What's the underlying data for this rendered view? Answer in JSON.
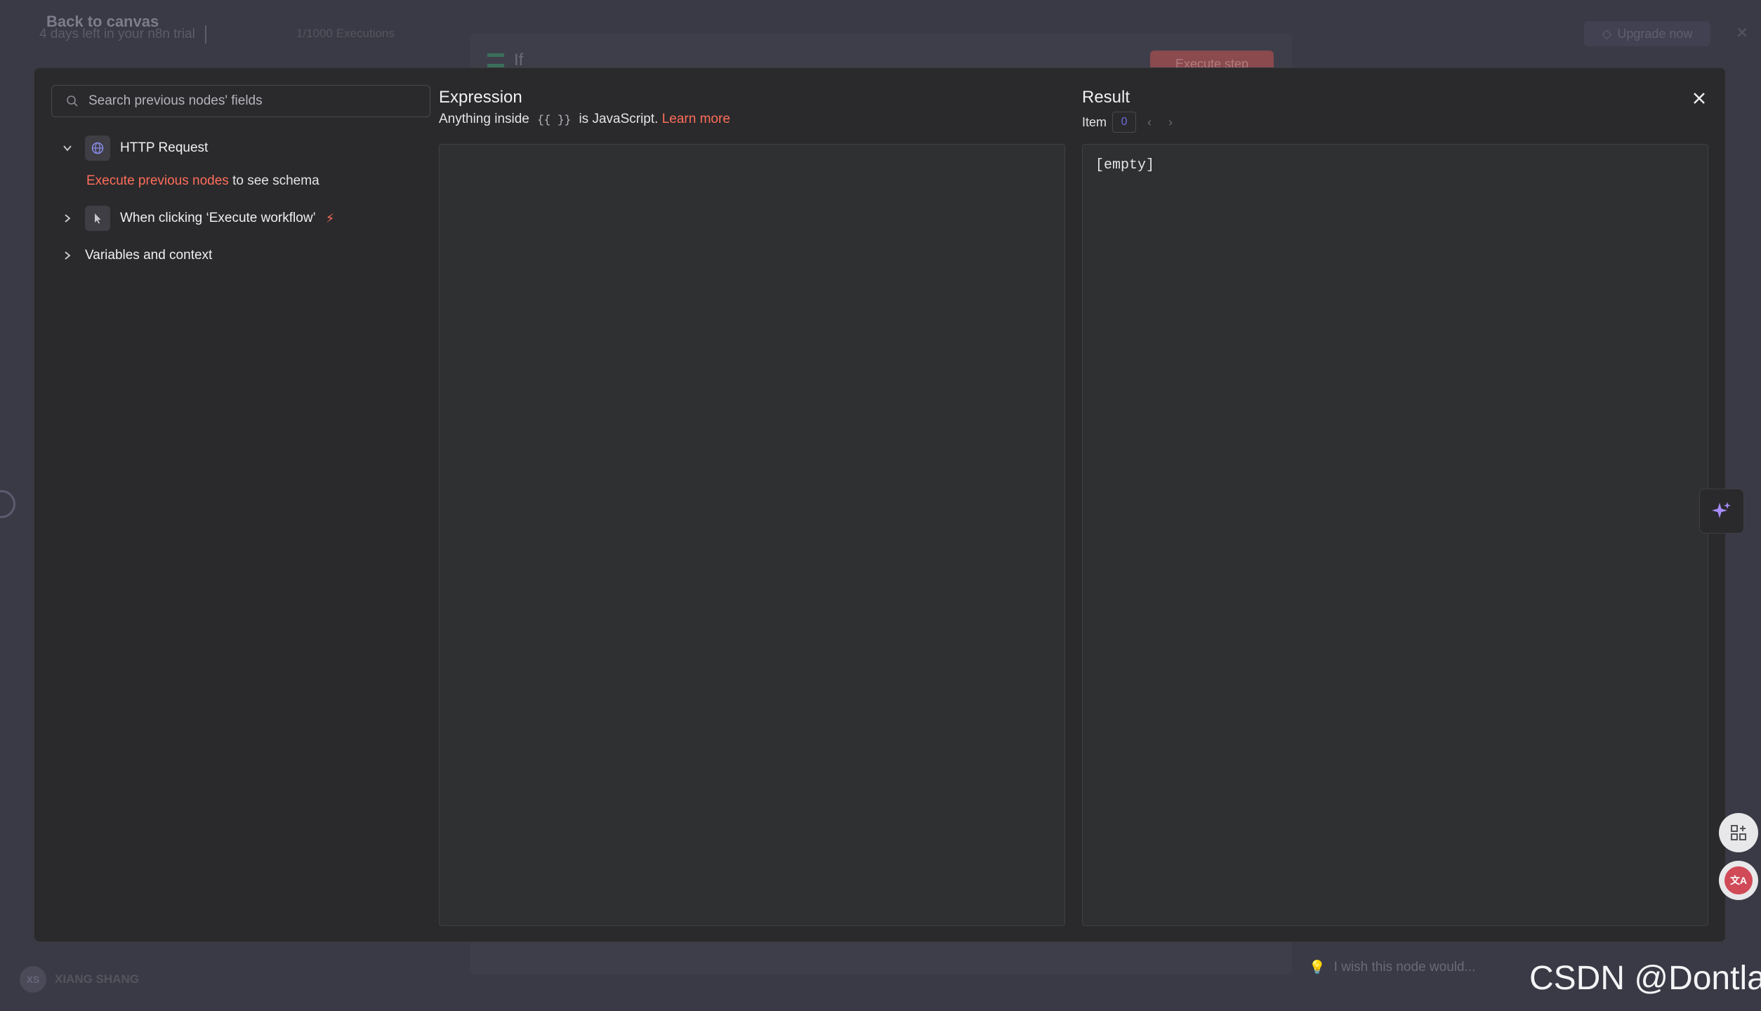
{
  "background": {
    "back_label": "Back to canvas",
    "trial_text": "4 days left in your n8n trial",
    "executions_text": "1/1000 Executions",
    "upgrade_label": "Upgrade now",
    "node_name": "If",
    "execute_step_label": "Execute step",
    "user_initials": "XS",
    "user_name": "XIANG SHANG",
    "wish_placeholder": "I wish this node would..."
  },
  "search": {
    "placeholder": "Search previous nodes' fields"
  },
  "tree": {
    "http_request": "HTTP Request",
    "schema_link": "Execute previous nodes",
    "schema_suffix": " to see schema",
    "trigger": "When clicking ‘Execute workflow’",
    "variables": "Variables and context"
  },
  "expression": {
    "title": "Expression",
    "subtitle_prefix": "Anything inside ",
    "code_chip": "{{ }}",
    "subtitle_suffix": " is JavaScript. ",
    "learn_more": "Learn more"
  },
  "result": {
    "title": "Result",
    "item_label": "Item",
    "item_index": "0",
    "empty_text": "[empty]"
  },
  "watermark": "CSDN @Dontla",
  "colors": {
    "accent": "#ff6d5a",
    "modal_bg": "#2a2a2c",
    "pane_bg": "#2f3031",
    "overlay_bg": "#3a3a46"
  }
}
